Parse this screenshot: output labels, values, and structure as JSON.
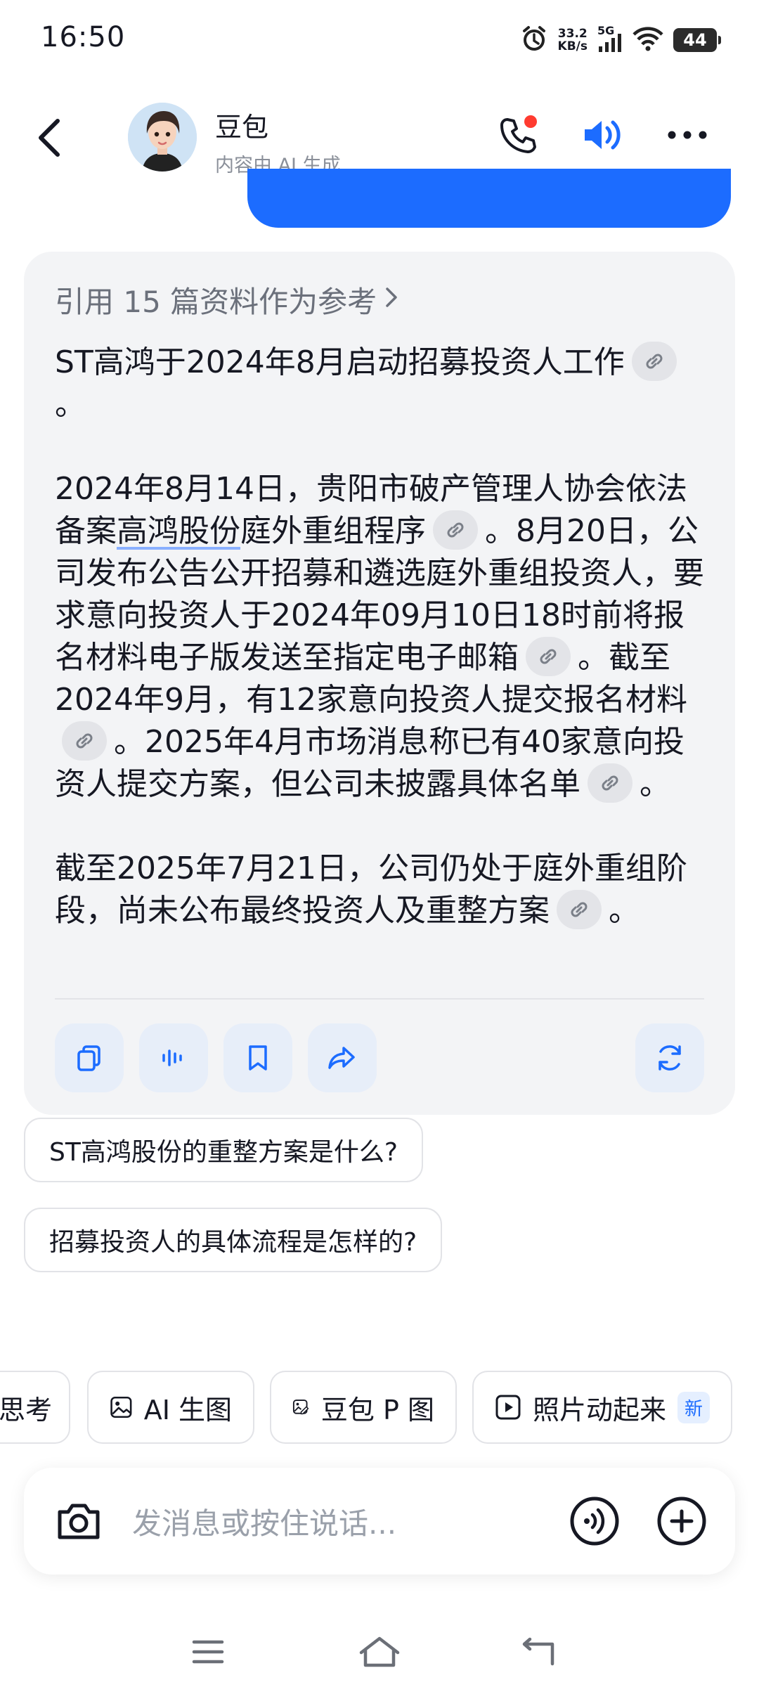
{
  "status_bar": {
    "time": "16:50",
    "speed_value": "33.2",
    "speed_unit": "KB/s",
    "network": "5G",
    "battery": "44",
    "icons": [
      "alarm-icon",
      "signal-icon",
      "wifi-icon",
      "battery-icon"
    ]
  },
  "header": {
    "title": "豆包",
    "subtitle": "内容由 AI 生成",
    "icons": [
      "back-icon",
      "phone-icon",
      "speaker-icon",
      "more-icon"
    ]
  },
  "answer": {
    "references_label": "引用 15 篇资料作为参考",
    "p1": [
      "ST高鸿于2024年8月启动招募投资人工作",
      "。"
    ],
    "p2": [
      "2024年8月14日，贵阳市破产管理人协会依法备案",
      "高鸿股份",
      "庭外重组程序",
      "。8月20日，公司发布公告公开招募和遴选庭外重组投资人，要求意向投资人于2024年09月10日18时前将报名材料电子版发送至指定电子邮箱",
      "。截至2024年9月，有12家意向投资人提交报名材料",
      "。2025年4月市场消息称已有40家意向投资人提交方案，但公司未披露具体名单",
      "。"
    ],
    "p3": [
      "截至2025年7月21日，公司仍处于庭外重组阶段，尚未公布最终投资人及重整方案",
      "。"
    ],
    "action_icons": [
      "copy-icon",
      "voice-play-icon",
      "bookmark-icon",
      "share-icon",
      "regenerate-icon"
    ]
  },
  "suggestions": [
    "ST高鸿股份的重整方案是什么?",
    "招募投资人的具体流程是怎样的?"
  ],
  "chips": {
    "c0": "思考",
    "c1": "AI 生图",
    "c2": "豆包 P 图",
    "c3": "照片动起来",
    "new_badge": "新"
  },
  "input": {
    "placeholder": "发消息或按住说话..."
  },
  "colors": {
    "accent": "#1c6cff",
    "card_bg": "#f3f4f6",
    "action_bg": "#e7eef9"
  }
}
